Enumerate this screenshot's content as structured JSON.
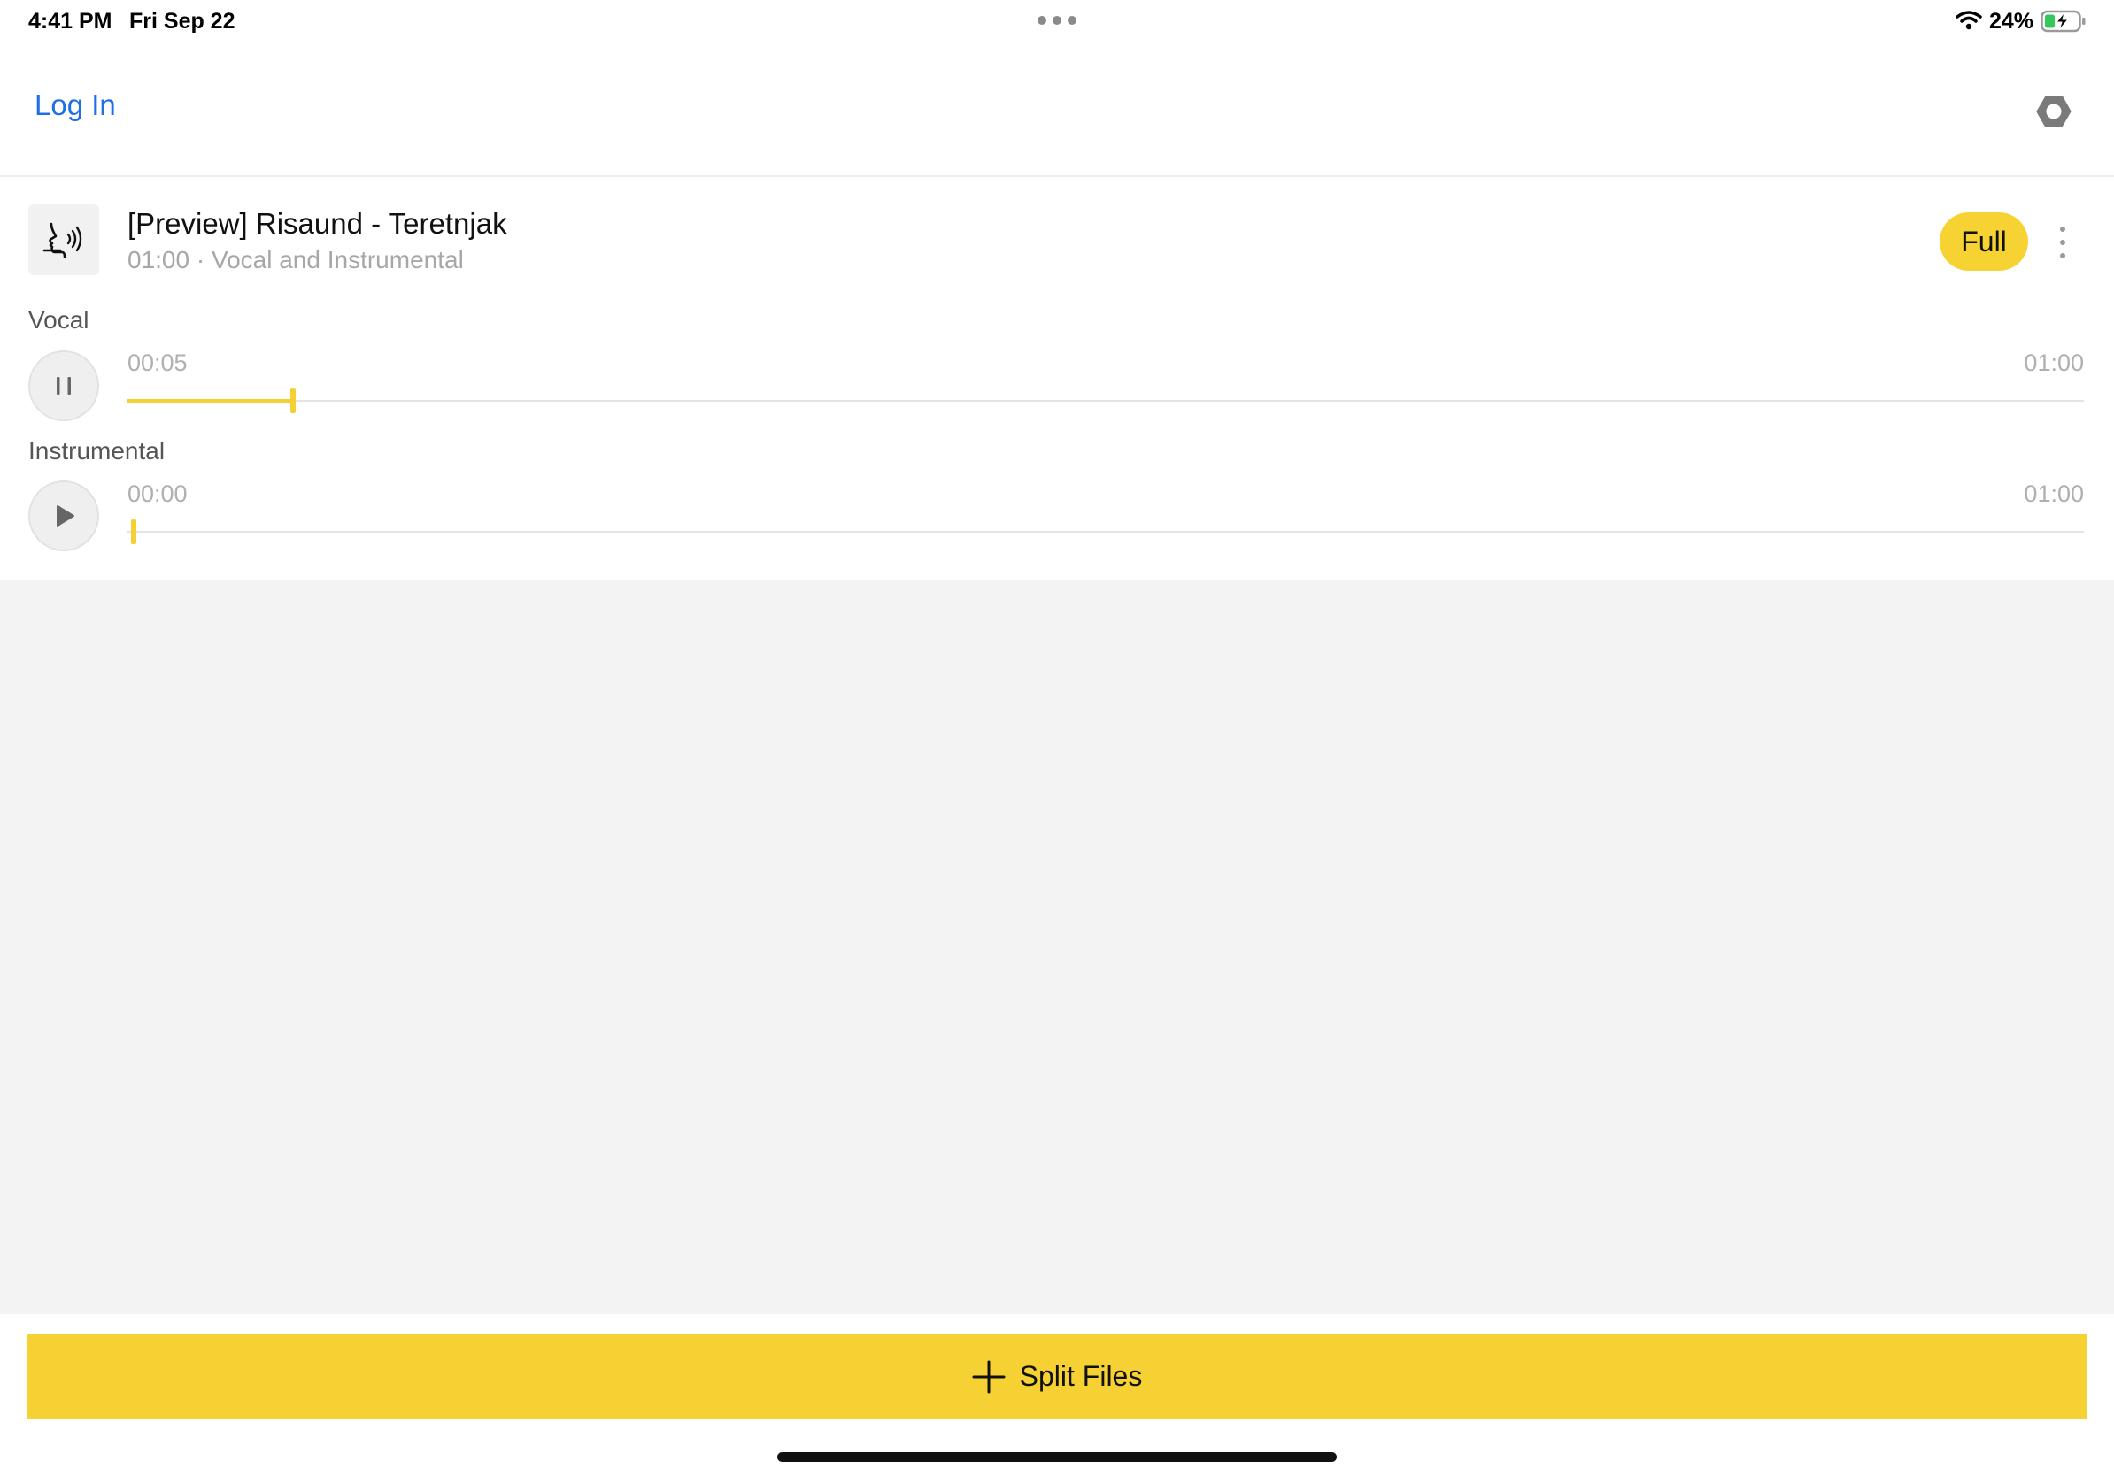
{
  "status_bar": {
    "time": "4:41 PM",
    "date": "Fri Sep 22",
    "battery": "24%"
  },
  "header": {
    "login": "Log In",
    "settings_icon": "gear-icon"
  },
  "track": {
    "title": "[Preview] Risaund - Teretnjak",
    "subtitle": "01:00 · Vocal and Instrumental",
    "badge": "Full",
    "thumbnail_icon": "voice-icon"
  },
  "vocal": {
    "label": "Vocal",
    "current": "00:05",
    "duration": "01:00",
    "progress": 0.0833,
    "state": "playing"
  },
  "instrumental": {
    "label": "Instrumental",
    "current": "00:00",
    "duration": "01:00",
    "progress": 0.0,
    "state": "paused"
  },
  "footer": {
    "split_label": "Split Files"
  },
  "colors": {
    "accent": "#f6d133",
    "link": "#1f6fe5"
  }
}
